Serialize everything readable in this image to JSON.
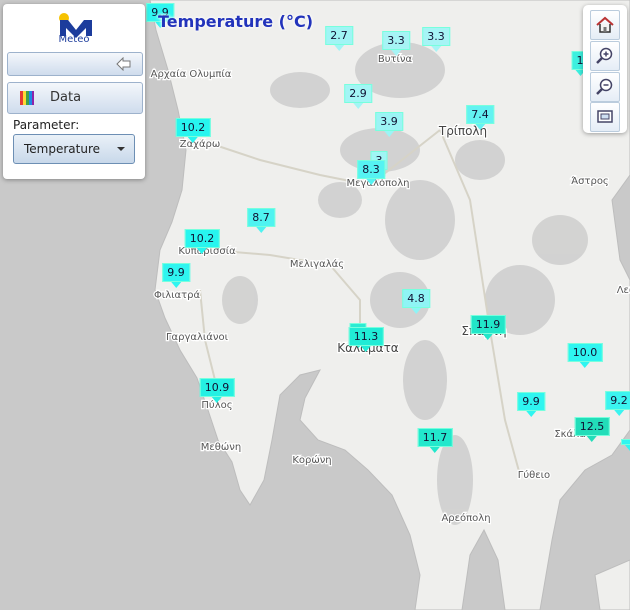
{
  "map": {
    "title": "Temperature (°C)",
    "places": [
      {
        "id": "vytina",
        "label": "Βυτίνα"
      },
      {
        "id": "tripoli",
        "label": "Τρίπολη"
      },
      {
        "id": "archaia-olympia",
        "label": "Αρχαία Ολυμπία"
      },
      {
        "id": "zacharo",
        "label": "Ζαχάρω"
      },
      {
        "id": "megalopoli",
        "label": "Μεγαλόπολη"
      },
      {
        "id": "astros",
        "label": "Άστρος"
      },
      {
        "id": "kyparissia",
        "label": "Κυπαρισσία"
      },
      {
        "id": "meligalas",
        "label": "Μελιγαλάς"
      },
      {
        "id": "filiatra",
        "label": "Φιλιατρά"
      },
      {
        "id": "gargaliani",
        "label": "Γαργαλιάνοι"
      },
      {
        "id": "kalamata",
        "label": "Καλαμάτα"
      },
      {
        "id": "sparti",
        "label": "Σπάρτη"
      },
      {
        "id": "leonidio",
        "label": "Λεω"
      },
      {
        "id": "pylos",
        "label": "Πύλος"
      },
      {
        "id": "methoni",
        "label": "Μεθώνη"
      },
      {
        "id": "koroni",
        "label": "Κορώνη"
      },
      {
        "id": "skala",
        "label": "Σκάλα"
      },
      {
        "id": "gytheio",
        "label": "Γύθειο"
      },
      {
        "id": "areopoli",
        "label": "Αρεόπολη"
      }
    ],
    "stations": [
      {
        "value": "9.9",
        "color": "#2ff5f0"
      },
      {
        "value": "2.7",
        "color": "#a0f5f5"
      },
      {
        "value": "3.3",
        "color": "#a6f4f5"
      },
      {
        "value": "3.3",
        "color": "#a6f4f5"
      },
      {
        "value": "1",
        "color": "#3cf0df"
      },
      {
        "value": "2.9",
        "color": "#a3f5f5"
      },
      {
        "value": "7.4",
        "color": "#63f2f2"
      },
      {
        "value": "10.2",
        "color": "#27f5ef"
      },
      {
        "value": "3.9",
        "color": "#9cf4f5"
      },
      {
        "value": "3",
        "color": "#a0f5f5"
      },
      {
        "value": "8.3",
        "color": "#55f3f2"
      },
      {
        "value": "8.7",
        "color": "#4ff3f1"
      },
      {
        "value": "10.2",
        "color": "#27f5ef"
      },
      {
        "value": "9.9",
        "color": "#2ff5f0"
      },
      {
        "value": "4.8",
        "color": "#8ff4f5"
      },
      {
        "value": "11.9",
        "color": "#22e6c9"
      },
      {
        "value": "1",
        "color": "#2bebd3"
      },
      {
        "value": "11.3",
        "color": "#21ecd6"
      },
      {
        "value": "10.0",
        "color": "#2ef5f0"
      },
      {
        "value": "9.9",
        "color": "#2ff5f0"
      },
      {
        "value": "9.2",
        "color": "#3bf4f0"
      },
      {
        "value": "10.9",
        "color": "#25f0e3"
      },
      {
        "value": "12.5",
        "color": "#22ddb9"
      },
      {
        "value": "11.7",
        "color": "#22e8cc"
      },
      {
        "value": "",
        "color": "#2ff5f0"
      }
    ]
  },
  "panel": {
    "logo_text": "Meteo",
    "data_button_label": "Data",
    "parameter_label": "Parameter:",
    "parameter_value": "Temperature"
  },
  "controls": {
    "home": "home-icon",
    "zoom_in": "zoom-in-icon",
    "zoom_out": "zoom-out-icon",
    "extent": "full-extent-icon"
  },
  "colors": {
    "sea": "#c9c9c9",
    "land": "#efefed",
    "accent_title": "#2233bb",
    "marker_cold": "#a6f4f5",
    "marker_warm": "#22ddb9"
  }
}
